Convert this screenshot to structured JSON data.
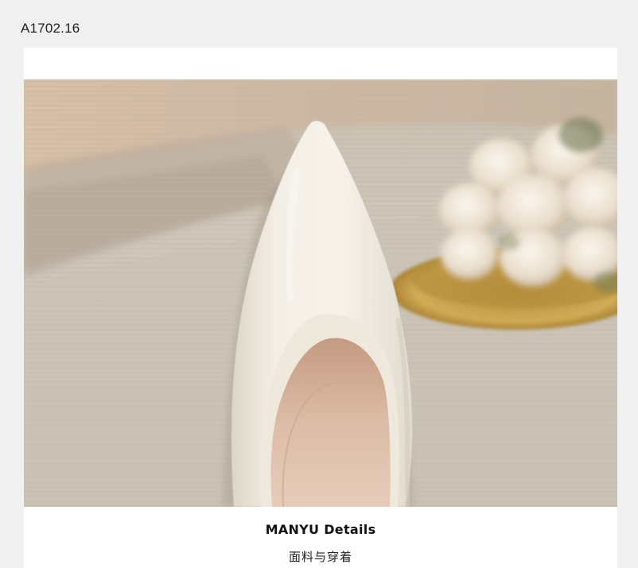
{
  "product": {
    "code": "A1702.16"
  },
  "details": {
    "title": "MANYU Details",
    "subtitle": "面料与穿着"
  },
  "photo": {
    "subject": "shoe-icon",
    "palette": {
      "background": "#cfc6b8",
      "shoe": "#f3eee5",
      "lining": "#d9b8a2",
      "tray": "#c9a24a",
      "flowers": "#efe6d8"
    }
  }
}
